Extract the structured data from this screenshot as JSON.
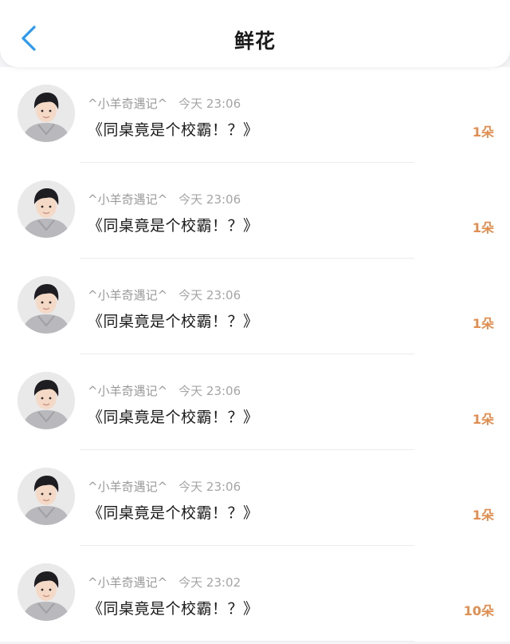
{
  "header": {
    "title": "鲜花"
  },
  "colors": {
    "back_arrow": "#2b9af3",
    "count": "#e38d4e"
  },
  "items": [
    {
      "user": "^小羊奇遇记^",
      "time": "今天 23:06",
      "title": "《同桌竟是个校霸！？》",
      "count": "1朵"
    },
    {
      "user": "^小羊奇遇记^",
      "time": "今天 23:06",
      "title": "《同桌竟是个校霸！？》",
      "count": "1朵"
    },
    {
      "user": "^小羊奇遇记^",
      "time": "今天 23:06",
      "title": "《同桌竟是个校霸！？》",
      "count": "1朵"
    },
    {
      "user": "^小羊奇遇记^",
      "time": "今天 23:06",
      "title": "《同桌竟是个校霸！？》",
      "count": "1朵"
    },
    {
      "user": "^小羊奇遇记^",
      "time": "今天 23:06",
      "title": "《同桌竟是个校霸！？》",
      "count": "1朵"
    },
    {
      "user": "^小羊奇遇记^",
      "time": "今天 23:02",
      "title": "《同桌竟是个校霸！？》",
      "count": "10朵"
    }
  ]
}
